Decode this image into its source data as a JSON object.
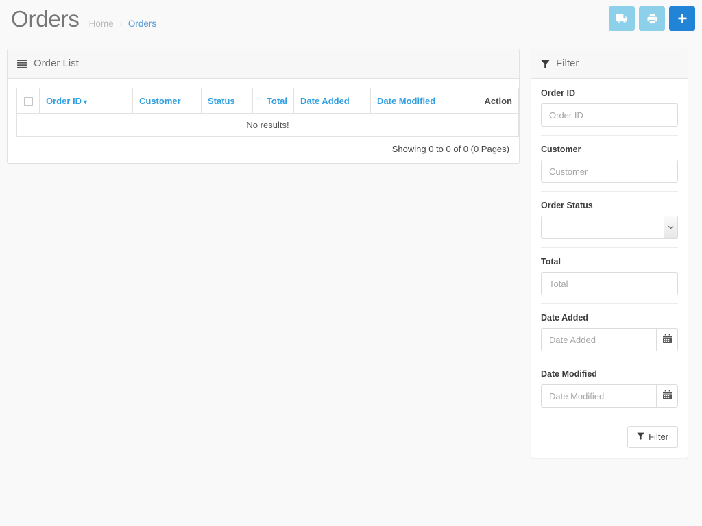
{
  "header": {
    "title": "Orders",
    "breadcrumb": {
      "home": "Home",
      "separator": "›",
      "current": "Orders"
    },
    "actions": [
      {
        "name": "shipping-button",
        "icon": "truck-icon",
        "style": "#8cd0ea"
      },
      {
        "name": "print-invoice-button",
        "icon": "printer-icon",
        "style": "#8cd0ea"
      },
      {
        "name": "add-new-button",
        "icon": "plus-icon",
        "style": "#2284d6"
      }
    ]
  },
  "order_list": {
    "panel_title": "Order List",
    "panel_icon": "list-icon",
    "columns": [
      {
        "label": "",
        "icon": "select-all-checkbox"
      },
      {
        "label": "Order ID",
        "sorted": true,
        "sort_icon": "chevron-down-icon"
      },
      {
        "label": "Customer"
      },
      {
        "label": "Status"
      },
      {
        "label": "Total"
      },
      {
        "label": "Date Added"
      },
      {
        "label": "Date Modified"
      },
      {
        "label": "Action"
      }
    ],
    "empty_message": "No results!",
    "pagination_text": "Showing 0 to 0 of 0 (0 Pages)"
  },
  "filter": {
    "panel_title": "Filter",
    "panel_icon": "filter-icon",
    "fields": {
      "order_id": {
        "label": "Order ID",
        "placeholder": "Order ID",
        "value": ""
      },
      "customer": {
        "label": "Customer",
        "placeholder": "Customer",
        "value": ""
      },
      "order_status": {
        "label": "Order Status",
        "value": ""
      },
      "total": {
        "label": "Total",
        "placeholder": "Total",
        "value": ""
      },
      "date_added": {
        "label": "Date Added",
        "placeholder": "Date Added",
        "value": "",
        "button_icon": "calendar-icon"
      },
      "date_modified": {
        "label": "Date Modified",
        "placeholder": "Date Modified",
        "value": "",
        "button_icon": "calendar-icon"
      }
    },
    "submit_label": "Filter",
    "submit_icon": "filter-icon"
  },
  "colors": {
    "accent": "#2f9fe0",
    "primary_button": "#2284d6",
    "info_button": "#8cd0ea",
    "page_background": "#f9f9f9",
    "link": "#5a9ad4"
  }
}
